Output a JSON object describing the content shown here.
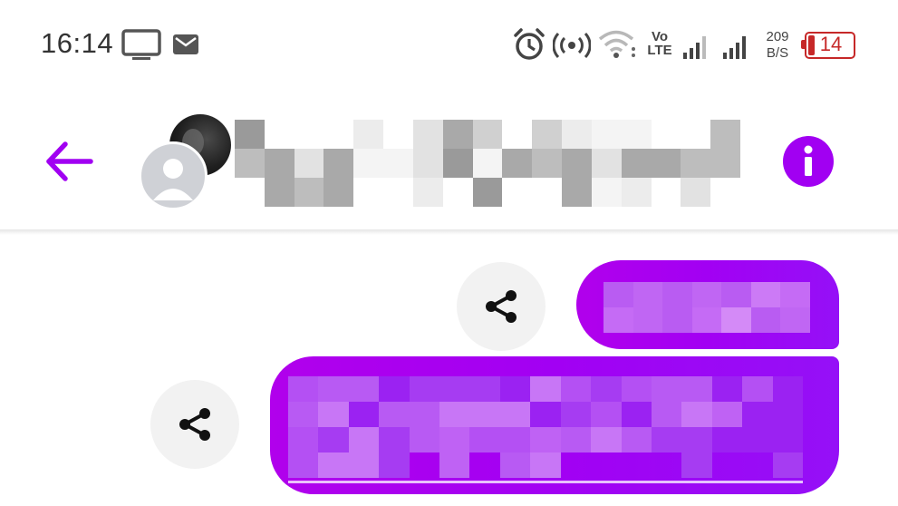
{
  "status_bar": {
    "time": "16:14",
    "volte_top": "Vo",
    "volte_bottom": "LTE",
    "net_speed_value": "209",
    "net_speed_unit": "B/S",
    "battery_level": "14",
    "battery_fraction": 0.14,
    "battery_color": "#c62828",
    "icons": [
      "tv-icon",
      "mail-icon",
      "alarm-icon",
      "hotspot-icon",
      "wifi-icon",
      "signal-icon",
      "signal-icon",
      "battery-icon"
    ]
  },
  "header": {
    "back_icon": "arrow-left-icon",
    "info_icon": "info-icon",
    "accent_color": "#a100f2",
    "contact_name_redacted": true
  },
  "messages": [
    {
      "direction": "outgoing",
      "redacted": true,
      "action_icon": "share-icon"
    },
    {
      "direction": "outgoing",
      "redacted": true,
      "action_icon": "share-icon"
    }
  ],
  "colors": {
    "bubble_start": "#b100ec",
    "bubble_end": "#9510f7",
    "share_bg": "#f2f2f2",
    "background": "#ffffff"
  }
}
